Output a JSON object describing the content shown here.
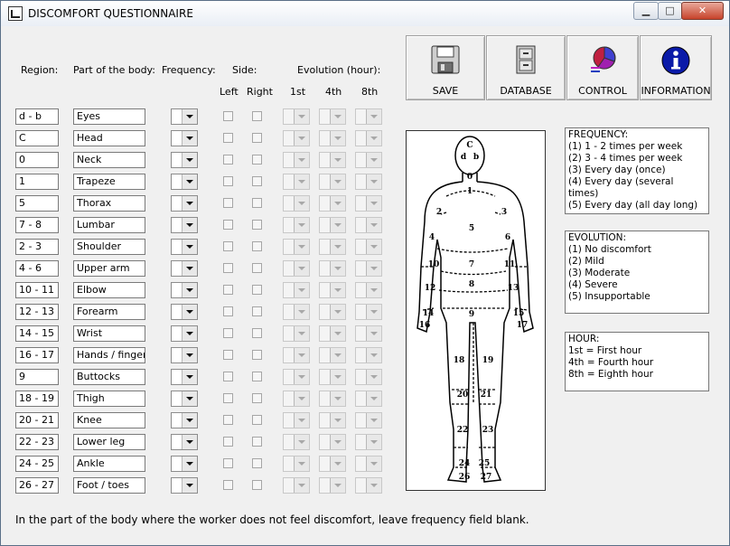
{
  "window": {
    "title": "DISCOMFORT QUESTIONNAIRE",
    "minimize": "▁",
    "maximize": "□",
    "close": "✕"
  },
  "headers": {
    "region": "Region:",
    "part": "Part of the body:",
    "frequency": "Frequency:",
    "side": "Side:",
    "left": "Left",
    "right": "Right",
    "evolution": "Evolution (hour):",
    "h1": "1st",
    "h4": "4th",
    "h8": "8th"
  },
  "rows": [
    {
      "region": "d - b",
      "part": "Eyes"
    },
    {
      "region": "C",
      "part": "Head"
    },
    {
      "region": "0",
      "part": "Neck"
    },
    {
      "region": "1",
      "part": "Trapeze"
    },
    {
      "region": "5",
      "part": "Thorax"
    },
    {
      "region": "7 - 8",
      "part": "Lumbar"
    },
    {
      "region": "2 - 3",
      "part": "Shoulder"
    },
    {
      "region": "4 - 6",
      "part": "Upper arm"
    },
    {
      "region": "10 - 11",
      "part": "Elbow"
    },
    {
      "region": "12 - 13",
      "part": "Forearm"
    },
    {
      "region": "14 - 15",
      "part": "Wrist"
    },
    {
      "region": "16 - 17",
      "part": "Hands / fingers"
    },
    {
      "region": "9",
      "part": "Buttocks"
    },
    {
      "region": "18 - 19",
      "part": "Thigh"
    },
    {
      "region": "20 - 21",
      "part": "Knee"
    },
    {
      "region": "22 - 23",
      "part": "Lower leg"
    },
    {
      "region": "24 - 25",
      "part": "Ankle"
    },
    {
      "region": "26 - 27",
      "part": "Foot / toes"
    }
  ],
  "buttons": {
    "save": {
      "label": "SAVE",
      "icon": "floppy-disk-icon"
    },
    "database": {
      "label": "DATABASE",
      "icon": "file-cabinet-icon"
    },
    "control": {
      "label": "CONTROL",
      "icon": "pie-chart-icon"
    },
    "information": {
      "label": "INFORMATION",
      "icon": "info-icon"
    }
  },
  "frequency_box": {
    "title": "FREQUENCY:",
    "lines": [
      "(1) 1 - 2 times per week",
      "(2) 3 - 4 times per week",
      "(3) Every day (once)",
      "(4) Every day (several times)",
      "(5) Every day (all day long)"
    ]
  },
  "evolution_box": {
    "title": "EVOLUTION:",
    "lines": [
      "(1) No discomfort",
      "(2) Mild",
      "(3) Moderate",
      "(4) Severe",
      "(5) Insupportable"
    ]
  },
  "hour_box": {
    "title": "HOUR:",
    "lines": [
      "1st = First hour",
      "4th = Fourth hour",
      "8th = Eighth hour"
    ]
  },
  "body_map_labels": [
    "C",
    "d",
    "b",
    "0",
    "1",
    "2",
    "3",
    "4",
    "5",
    "6",
    "7",
    "8",
    "9",
    "10",
    "11",
    "12",
    "13",
    "14",
    "15",
    "16",
    "17",
    "18",
    "19",
    "20",
    "21",
    "22",
    "23",
    "24",
    "25",
    "26",
    "27"
  ],
  "footer": "In the part of the body where the worker does not feel discomfort, leave frequency field blank."
}
